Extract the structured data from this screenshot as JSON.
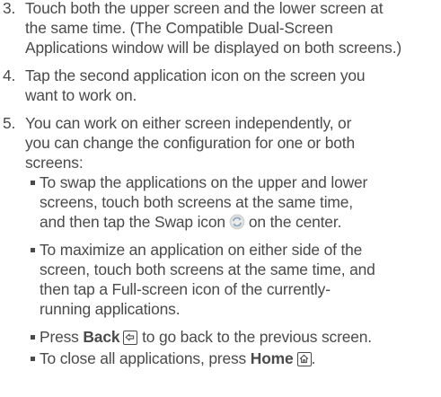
{
  "steps": [
    {
      "number": "3.",
      "lines": [
        "Touch both the upper screen and the lower screen at",
        "the same time. (The Compatible Dual-Screen",
        "Applications window will be displayed on both screens.)"
      ]
    },
    {
      "number": "4.",
      "lines": [
        "Tap the second application icon on the screen you",
        "want to work on."
      ]
    },
    {
      "number": "5.",
      "lines": [
        "You can work on either screen independently, or",
        "you can change the configuration for one or both",
        "screens:"
      ]
    }
  ],
  "bullets": {
    "swap": {
      "lines": [
        "To swap the applications on the upper and lower",
        "screens, touch both screens at the same time,"
      ],
      "last_before": "and then tap the Swap icon",
      "last_after": "on the center.",
      "icon": "swap-icon"
    },
    "maximize": {
      "lines": [
        "To maximize an application on either side of the",
        "screen, touch both screens at the same time, and",
        "then tap a Full-screen icon of the currently-",
        "running applications."
      ]
    },
    "back": {
      "before": "Press",
      "key": "Back",
      "after": "to go back to the previous screen.",
      "icon": "back-key-icon"
    },
    "home": {
      "before": "To close all applications, press",
      "key": "Home",
      "after": ".",
      "icon": "home-key-icon"
    }
  },
  "colors": {
    "text": "#4a4a4a",
    "swap_icon_outer": "#c8c8c8",
    "swap_icon_inner": "#9fb4c8"
  }
}
